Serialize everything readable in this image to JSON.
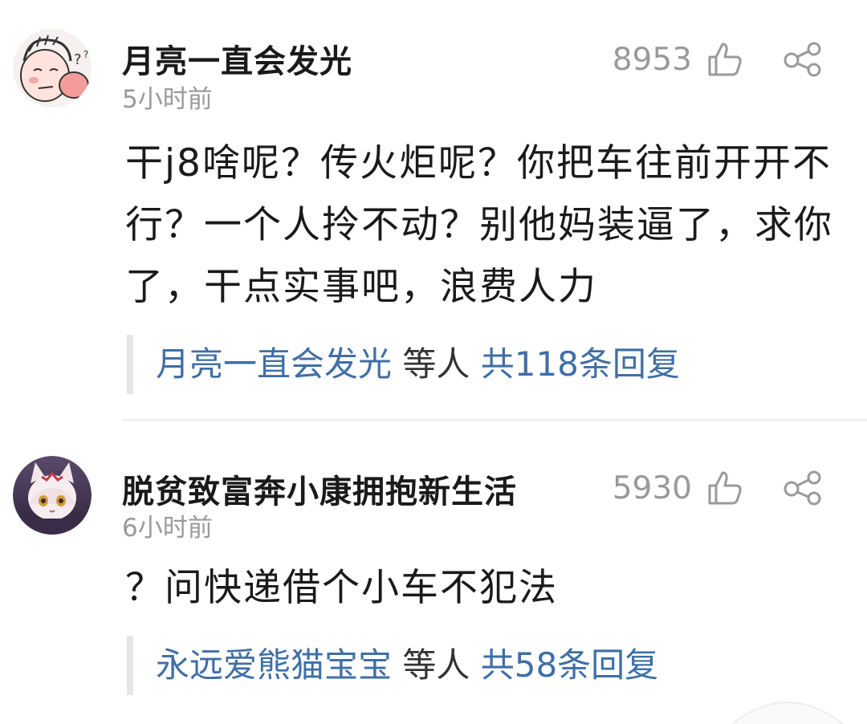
{
  "comments": [
    {
      "username": "月亮一直会发光",
      "time": "5小时前",
      "likes": "8953",
      "text": "干j8啥呢？传火炬呢？你把车往前开开不行？一个人拎不动？别他妈装逼了，求你了，干点实事吧，浪费人力",
      "replies": {
        "user": "月亮一直会发光",
        "middle": " 等人 ",
        "count": "共118条回复"
      },
      "avatar_icon": "cartoon-face-avatar",
      "like_icon": "thumbs-up-icon",
      "share_icon": "share-icon"
    },
    {
      "username": "脱贫致富奔小康拥抱新生活",
      "time": "6小时前",
      "likes": "5930",
      "text": "？问快递借个小车不犯法",
      "replies": {
        "user": "永远爱熊猫宝宝",
        "middle": " 等人 ",
        "count": "共58条回复"
      },
      "avatar_icon": "anime-cat-girl-avatar",
      "like_icon": "thumbs-up-icon",
      "share_icon": "share-icon"
    }
  ],
  "colors": {
    "username": "#1a1a1a",
    "meta": "#9a9a9a",
    "reply_link": "#3f6fa6",
    "reply_bar": "#e6e6e6"
  }
}
